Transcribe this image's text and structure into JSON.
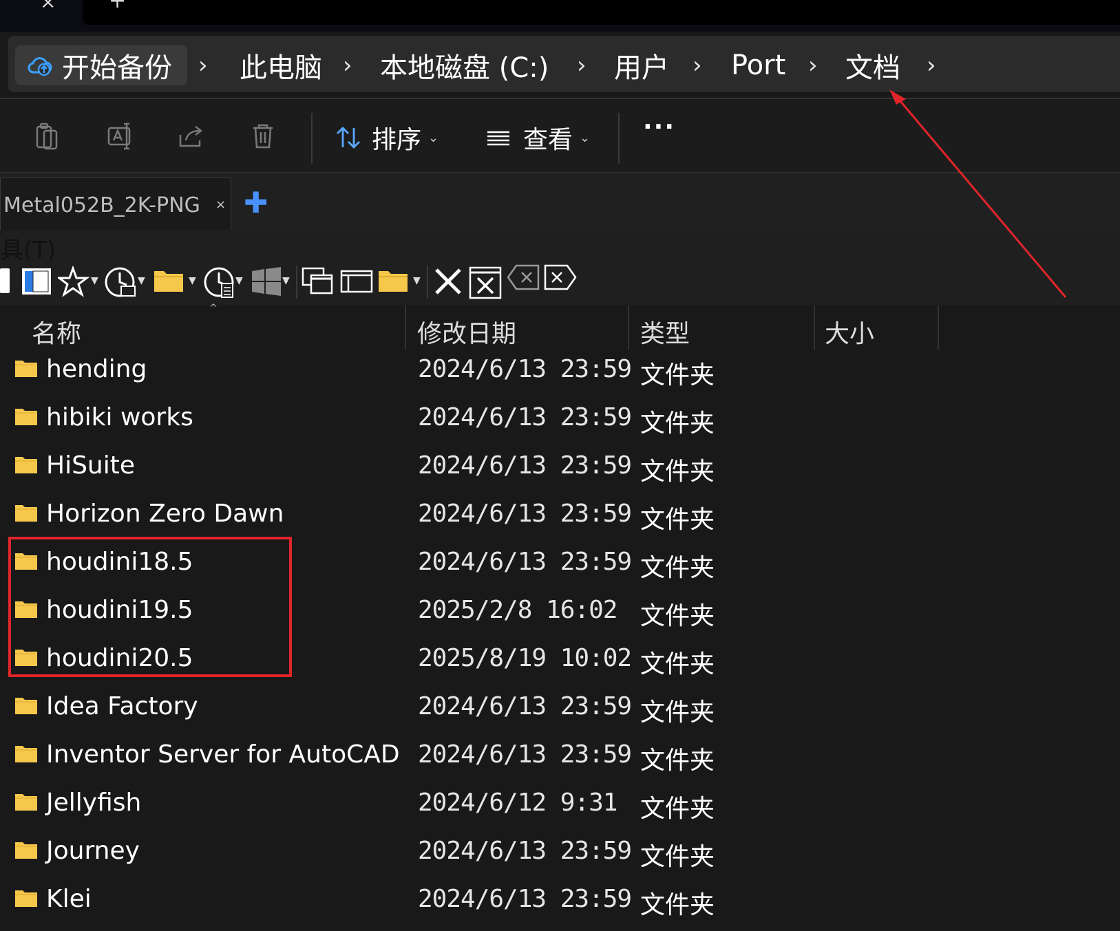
{
  "titlebar": {
    "close_glyph": "×",
    "new_tab_glyph": "+"
  },
  "breadcrumb": {
    "backup_label": "开始备份",
    "backup_icon": "cloud-backup-icon",
    "separator": "›",
    "items": [
      {
        "label": "此电脑"
      },
      {
        "label": "本地磁盘 (C:)"
      },
      {
        "label": "用户"
      },
      {
        "label": "Port"
      },
      {
        "label": "文档"
      }
    ]
  },
  "toolbar": {
    "icons": [
      "copy-icon",
      "rename-icon",
      "share-icon",
      "delete-icon"
    ],
    "sort_label": "排序",
    "view_label": "查看",
    "more_label": "···"
  },
  "qttabbar": {
    "tab_label": "Metal052B_2K-PNG",
    "tab_close": "×",
    "add_tab": "✚",
    "menu_label": "具(T)"
  },
  "columns": {
    "name": "名称",
    "modified": "修改日期",
    "type": "类型",
    "size": "大小"
  },
  "files": [
    {
      "name": "hending",
      "modified": "2024/6/13 23:59",
      "type": "文件夹"
    },
    {
      "name": "hibiki works",
      "modified": "2024/6/13 23:59",
      "type": "文件夹"
    },
    {
      "name": "HiSuite",
      "modified": "2024/6/13 23:59",
      "type": "文件夹"
    },
    {
      "name": "Horizon Zero Dawn",
      "modified": "2024/6/13 23:59",
      "type": "文件夹"
    },
    {
      "name": "houdini18.5",
      "modified": "2024/6/13 23:59",
      "type": "文件夹"
    },
    {
      "name": "houdini19.5",
      "modified": "2025/2/8 16:02",
      "type": "文件夹"
    },
    {
      "name": "houdini20.5",
      "modified": "2025/8/19 10:02",
      "type": "文件夹"
    },
    {
      "name": "Idea Factory",
      "modified": "2024/6/13 23:59",
      "type": "文件夹"
    },
    {
      "name": "Inventor Server for AutoCAD",
      "modified": "2024/6/13 23:59",
      "type": "文件夹"
    },
    {
      "name": "Jellyfish",
      "modified": "2024/6/12 9:31",
      "type": "文件夹"
    },
    {
      "name": "Journey",
      "modified": "2024/6/13 23:59",
      "type": "文件夹"
    },
    {
      "name": "Klei",
      "modified": "2024/6/13 23:59",
      "type": "文件夹"
    }
  ],
  "colors": {
    "background": "#191919",
    "folder": "#f5c84c",
    "annotation": "#e0252b",
    "accent": "#4a90ff"
  }
}
